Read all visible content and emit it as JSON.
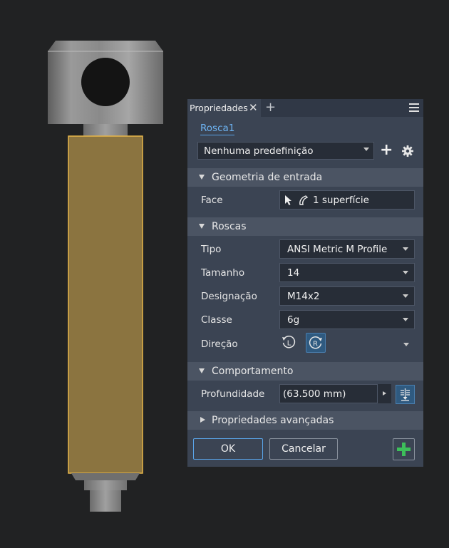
{
  "panel": {
    "tab_label": "Propriedades",
    "close_glyph": "✕",
    "add_tab_glyph": "+",
    "feature_name": "Rosca1",
    "preset": {
      "value": "Nenhuma predefinição",
      "add_glyph": "+"
    },
    "sections": {
      "input_geometry": "Geometria de entrada",
      "threads": "Roscas",
      "behavior": "Comportamento",
      "advanced": "Propriedades avançadas"
    },
    "face": {
      "label": "Face",
      "value": "1 superfície"
    },
    "threads": {
      "type": {
        "label": "Tipo",
        "value": "ANSI Metric M Profile"
      },
      "size": {
        "label": "Tamanho",
        "value": "14"
      },
      "designation": {
        "label": "Designação",
        "value": "M14x2"
      },
      "class": {
        "label": "Classe",
        "value": "6g"
      },
      "direction": {
        "label": "Direção",
        "left_glyph": "L",
        "right_glyph": "R",
        "selected": "right"
      }
    },
    "behavior": {
      "depth_label": "Profundidade",
      "depth_value": "(63.500 mm)"
    },
    "buttons": {
      "ok": "OK",
      "cancel": "Cancelar"
    }
  },
  "colors": {
    "panel_bg": "#3b4453",
    "section_bg": "#4b5463",
    "field_bg": "#272d37",
    "accent_blue": "#5aa4e8",
    "thread_face": "#8b7440",
    "selection_outline": "#e8b64a",
    "apply_green": "#3dbf5a"
  }
}
